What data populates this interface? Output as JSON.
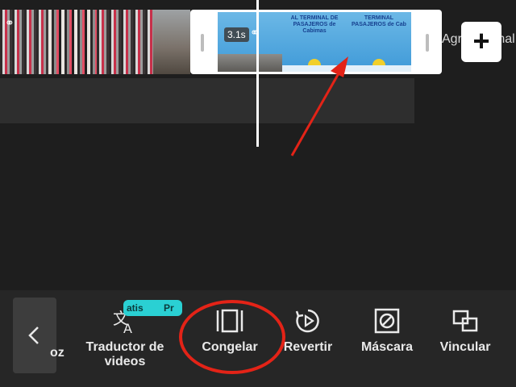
{
  "timeline": {
    "clip_duration": "3.1s",
    "add_ending_label": "Agregar final",
    "add_button_label": "+"
  },
  "toolbar": {
    "partial_tool_label": "oz",
    "tools": [
      {
        "id": "traductor",
        "label_line1": "Traductor de",
        "label_line2": "videos",
        "icon": "translate-icon"
      },
      {
        "id": "congelar",
        "label": "Congelar",
        "icon": "freeze-frame-icon"
      },
      {
        "id": "revertir",
        "label": "Revertir",
        "icon": "reverse-play-icon"
      },
      {
        "id": "mascara",
        "label": "Máscara",
        "icon": "mask-icon"
      },
      {
        "id": "vincular",
        "label": "Vincular",
        "icon": "link-icon"
      }
    ],
    "badge": {
      "left": "atis",
      "right": "Pr"
    }
  },
  "colors": {
    "background": "#1e1e1e",
    "toolbar": "#262626",
    "annotation": "#e32317",
    "badge": "#2ad0d3"
  },
  "signs": [
    "AL TERMINAL DE PASAJEROS de Cabimas",
    "TERMINAL PASAJEROS de Cab"
  ]
}
